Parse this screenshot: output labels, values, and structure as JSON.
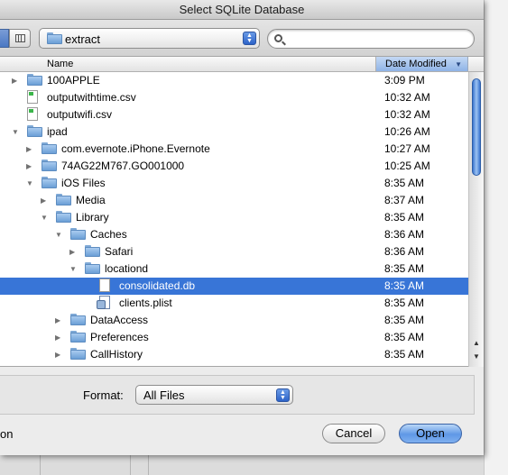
{
  "window": {
    "title": "Select SQLite Database"
  },
  "toolbar": {
    "path_popup": "extract",
    "search": {
      "value": "",
      "placeholder": ""
    }
  },
  "columns": {
    "name": "Name",
    "date": "Date Modified"
  },
  "rows": [
    {
      "name": "100APPLE",
      "date": "3:09 PM",
      "type": "folder",
      "depth": 0,
      "disclosure": "collapsed",
      "selected": false
    },
    {
      "name": "outputwithtime.csv",
      "date": "10:32 AM",
      "type": "file-csv",
      "depth": 0,
      "disclosure": "none",
      "selected": false
    },
    {
      "name": "outputwifi.csv",
      "date": "10:32 AM",
      "type": "file-csv",
      "depth": 0,
      "disclosure": "none",
      "selected": false
    },
    {
      "name": "ipad",
      "date": "10:26 AM",
      "type": "folder",
      "depth": 0,
      "disclosure": "expanded",
      "selected": false
    },
    {
      "name": "com.evernote.iPhone.Evernote",
      "date": "10:27 AM",
      "type": "folder",
      "depth": 1,
      "disclosure": "collapsed",
      "selected": false
    },
    {
      "name": "74AG22M767.GO001000",
      "date": "10:25 AM",
      "type": "folder",
      "depth": 1,
      "disclosure": "collapsed",
      "selected": false
    },
    {
      "name": "iOS Files",
      "date": "8:35 AM",
      "type": "folder",
      "depth": 1,
      "disclosure": "expanded",
      "selected": false
    },
    {
      "name": "Media",
      "date": "8:37 AM",
      "type": "folder",
      "depth": 2,
      "disclosure": "collapsed",
      "selected": false
    },
    {
      "name": "Library",
      "date": "8:35 AM",
      "type": "folder",
      "depth": 2,
      "disclosure": "expanded",
      "selected": false
    },
    {
      "name": "Caches",
      "date": "8:36 AM",
      "type": "folder",
      "depth": 3,
      "disclosure": "expanded",
      "selected": false
    },
    {
      "name": "Safari",
      "date": "8:36 AM",
      "type": "folder",
      "depth": 4,
      "disclosure": "collapsed",
      "selected": false
    },
    {
      "name": "locationd",
      "date": "8:35 AM",
      "type": "folder",
      "depth": 4,
      "disclosure": "expanded",
      "selected": false
    },
    {
      "name": "consolidated.db",
      "date": "8:35 AM",
      "type": "file-db",
      "depth": 5,
      "disclosure": "none",
      "selected": true
    },
    {
      "name": "clients.plist",
      "date": "8:35 AM",
      "type": "file-plist",
      "depth": 5,
      "disclosure": "none",
      "selected": false
    },
    {
      "name": "DataAccess",
      "date": "8:35 AM",
      "type": "folder",
      "depth": 3,
      "disclosure": "collapsed",
      "selected": false
    },
    {
      "name": "Preferences",
      "date": "8:35 AM",
      "type": "folder",
      "depth": 3,
      "disclosure": "collapsed",
      "selected": false
    },
    {
      "name": "CallHistory",
      "date": "8:35 AM",
      "type": "folder",
      "depth": 3,
      "disclosure": "collapsed",
      "selected": false
    }
  ],
  "format": {
    "label": "Format:",
    "value": "All Files"
  },
  "buttons": {
    "cancel": "Cancel",
    "open": "Open"
  },
  "cutoff_text": "on",
  "colors": {
    "selection": "#3875d7",
    "header_sorted": "#a9c6ef"
  }
}
